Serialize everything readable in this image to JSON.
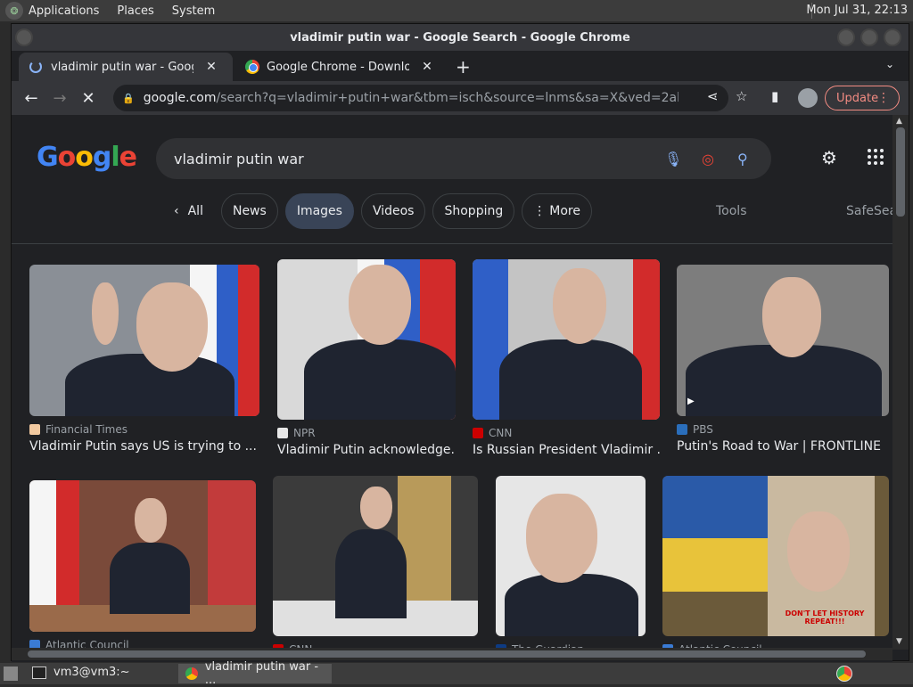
{
  "top_panel": {
    "menus": [
      "Applications",
      "Places",
      "System"
    ],
    "clock": "Mon Jul 31, 22:13"
  },
  "window": {
    "title": "vladimir putin war - Google Search - Google Chrome"
  },
  "tabs": [
    {
      "title": "vladimir putin war - Google Se",
      "loading": true
    },
    {
      "title": "Google Chrome - Download th",
      "loading": false
    }
  ],
  "toolbar": {
    "url_host": "google.com",
    "url_path": "/search?q=vladimir+putin+war&tbm=isch&source=lnms&sa=X&ved=2ahUKEwjRnsSA57...",
    "update_label": "Update"
  },
  "search": {
    "query": "vladimir putin war"
  },
  "chips": {
    "all": "All",
    "items": [
      "News",
      "Images",
      "Videos",
      "Shopping",
      "More"
    ],
    "active": "Images",
    "tools": "Tools",
    "safesearch": "SafeSea"
  },
  "results": [
    {
      "source": "Financial Times",
      "title": "Vladimir Putin says US is trying to ...",
      "fav_color": "#f2c9a0"
    },
    {
      "source": "NPR",
      "title": "Vladimir Putin acknowledge...",
      "fav_color": "#e8e8e8"
    },
    {
      "source": "CNN",
      "title": "Is Russian President Vladimir ...",
      "fav_color": "#cc0000"
    },
    {
      "source": "PBS",
      "title": "Putin's Road to War | FRONTLINE",
      "fav_color": "#2a6ebb"
    },
    {
      "source": "Atlantic Council",
      "title": "",
      "fav_color": "#3a7bd5"
    },
    {
      "source": "CNN",
      "title": "",
      "fav_color": "#cc0000"
    },
    {
      "source": "The Guardian",
      "title": "",
      "fav_color": "#0d3b84"
    },
    {
      "source": "Atlantic Council",
      "title": "",
      "fav_color": "#3a7bd5"
    }
  ],
  "poster_text": "DON'T LET HISTORY REPEAT!!!",
  "taskbar": {
    "terminal": "vm3@vm3:~",
    "chrome": "vladimir putin war - ..."
  }
}
